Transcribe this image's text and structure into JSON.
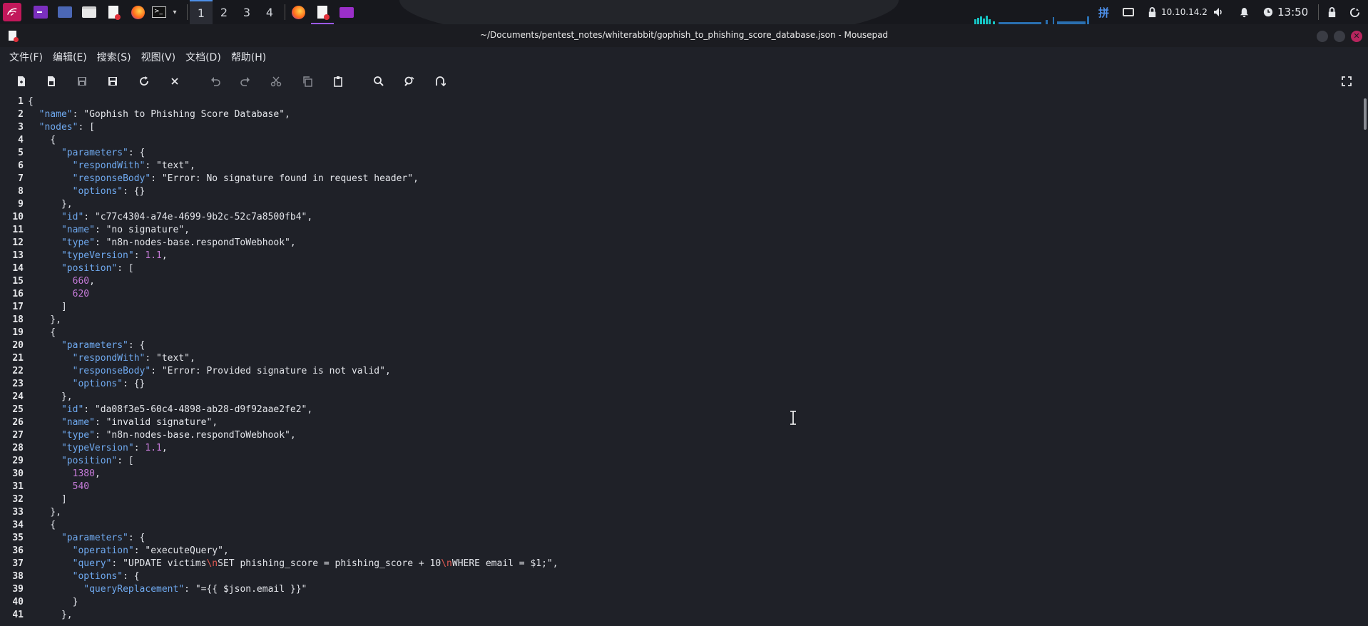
{
  "taskbar": {
    "workspaces": [
      "1",
      "2",
      "3",
      "4"
    ],
    "active_workspace": "1",
    "ip_address": "10.10.14.2",
    "time": "13:50",
    "accent_color": "#9b59f0"
  },
  "window": {
    "title": "~/Documents/pentest_notes/whiterabbit/gophish_to_phishing_score_database.json - Mousepad"
  },
  "menu": [
    "文件(F)",
    "编辑(E)",
    "搜索(S)",
    "视图(V)",
    "文档(D)",
    "帮助(H)"
  ],
  "toolbar": [
    "new-document-icon",
    "new-window-icon",
    "save-icon",
    "save-as-icon",
    "reload-icon",
    "close-icon",
    "undo-icon",
    "redo-icon",
    "cut-icon",
    "copy-icon",
    "paste-icon",
    "search-icon",
    "replace-icon",
    "goto-icon",
    "fullscreen-icon"
  ],
  "editor": {
    "lines": [
      [
        {
          "t": "p",
          "v": "{"
        }
      ],
      [
        {
          "t": "p",
          "v": "  "
        },
        {
          "t": "k",
          "v": "\"name\""
        },
        {
          "t": "p",
          "v": ": "
        },
        {
          "t": "s",
          "v": "\"Gophish to Phishing Score Database\""
        },
        {
          "t": "p",
          "v": ","
        }
      ],
      [
        {
          "t": "p",
          "v": "  "
        },
        {
          "t": "k",
          "v": "\"nodes\""
        },
        {
          "t": "p",
          "v": ": ["
        }
      ],
      [
        {
          "t": "p",
          "v": "    {"
        }
      ],
      [
        {
          "t": "p",
          "v": "      "
        },
        {
          "t": "k",
          "v": "\"parameters\""
        },
        {
          "t": "p",
          "v": ": {"
        }
      ],
      [
        {
          "t": "p",
          "v": "        "
        },
        {
          "t": "k",
          "v": "\"respondWith\""
        },
        {
          "t": "p",
          "v": ": "
        },
        {
          "t": "s",
          "v": "\"text\""
        },
        {
          "t": "p",
          "v": ","
        }
      ],
      [
        {
          "t": "p",
          "v": "        "
        },
        {
          "t": "k",
          "v": "\"responseBody\""
        },
        {
          "t": "p",
          "v": ": "
        },
        {
          "t": "s",
          "v": "\"Error: No signature found in request header\""
        },
        {
          "t": "p",
          "v": ","
        }
      ],
      [
        {
          "t": "p",
          "v": "        "
        },
        {
          "t": "k",
          "v": "\"options\""
        },
        {
          "t": "p",
          "v": ": {}"
        }
      ],
      [
        {
          "t": "p",
          "v": "      },"
        }
      ],
      [
        {
          "t": "p",
          "v": "      "
        },
        {
          "t": "k",
          "v": "\"id\""
        },
        {
          "t": "p",
          "v": ": "
        },
        {
          "t": "s",
          "v": "\"c77c4304-a74e-4699-9b2c-52c7a8500fb4\""
        },
        {
          "t": "p",
          "v": ","
        }
      ],
      [
        {
          "t": "p",
          "v": "      "
        },
        {
          "t": "k",
          "v": "\"name\""
        },
        {
          "t": "p",
          "v": ": "
        },
        {
          "t": "s",
          "v": "\"no signature\""
        },
        {
          "t": "p",
          "v": ","
        }
      ],
      [
        {
          "t": "p",
          "v": "      "
        },
        {
          "t": "k",
          "v": "\"type\""
        },
        {
          "t": "p",
          "v": ": "
        },
        {
          "t": "s",
          "v": "\"n8n-nodes-base.respondToWebhook\""
        },
        {
          "t": "p",
          "v": ","
        }
      ],
      [
        {
          "t": "p",
          "v": "      "
        },
        {
          "t": "k",
          "v": "\"typeVersion\""
        },
        {
          "t": "p",
          "v": ": "
        },
        {
          "t": "n",
          "v": "1.1"
        },
        {
          "t": "p",
          "v": ","
        }
      ],
      [
        {
          "t": "p",
          "v": "      "
        },
        {
          "t": "k",
          "v": "\"position\""
        },
        {
          "t": "p",
          "v": ": ["
        }
      ],
      [
        {
          "t": "p",
          "v": "        "
        },
        {
          "t": "n",
          "v": "660"
        },
        {
          "t": "p",
          "v": ","
        }
      ],
      [
        {
          "t": "p",
          "v": "        "
        },
        {
          "t": "n",
          "v": "620"
        }
      ],
      [
        {
          "t": "p",
          "v": "      ]"
        }
      ],
      [
        {
          "t": "p",
          "v": "    },"
        }
      ],
      [
        {
          "t": "p",
          "v": "    {"
        }
      ],
      [
        {
          "t": "p",
          "v": "      "
        },
        {
          "t": "k",
          "v": "\"parameters\""
        },
        {
          "t": "p",
          "v": ": {"
        }
      ],
      [
        {
          "t": "p",
          "v": "        "
        },
        {
          "t": "k",
          "v": "\"respondWith\""
        },
        {
          "t": "p",
          "v": ": "
        },
        {
          "t": "s",
          "v": "\"text\""
        },
        {
          "t": "p",
          "v": ","
        }
      ],
      [
        {
          "t": "p",
          "v": "        "
        },
        {
          "t": "k",
          "v": "\"responseBody\""
        },
        {
          "t": "p",
          "v": ": "
        },
        {
          "t": "s",
          "v": "\"Error: Provided signature is not valid\""
        },
        {
          "t": "p",
          "v": ","
        }
      ],
      [
        {
          "t": "p",
          "v": "        "
        },
        {
          "t": "k",
          "v": "\"options\""
        },
        {
          "t": "p",
          "v": ": {}"
        }
      ],
      [
        {
          "t": "p",
          "v": "      },"
        }
      ],
      [
        {
          "t": "p",
          "v": "      "
        },
        {
          "t": "k",
          "v": "\"id\""
        },
        {
          "t": "p",
          "v": ": "
        },
        {
          "t": "s",
          "v": "\"da08f3e5-60c4-4898-ab28-d9f92aae2fe2\""
        },
        {
          "t": "p",
          "v": ","
        }
      ],
      [
        {
          "t": "p",
          "v": "      "
        },
        {
          "t": "k",
          "v": "\"name\""
        },
        {
          "t": "p",
          "v": ": "
        },
        {
          "t": "s",
          "v": "\"invalid signature\""
        },
        {
          "t": "p",
          "v": ","
        }
      ],
      [
        {
          "t": "p",
          "v": "      "
        },
        {
          "t": "k",
          "v": "\"type\""
        },
        {
          "t": "p",
          "v": ": "
        },
        {
          "t": "s",
          "v": "\"n8n-nodes-base.respondToWebhook\""
        },
        {
          "t": "p",
          "v": ","
        }
      ],
      [
        {
          "t": "p",
          "v": "      "
        },
        {
          "t": "k",
          "v": "\"typeVersion\""
        },
        {
          "t": "p",
          "v": ": "
        },
        {
          "t": "n",
          "v": "1.1"
        },
        {
          "t": "p",
          "v": ","
        }
      ],
      [
        {
          "t": "p",
          "v": "      "
        },
        {
          "t": "k",
          "v": "\"position\""
        },
        {
          "t": "p",
          "v": ": ["
        }
      ],
      [
        {
          "t": "p",
          "v": "        "
        },
        {
          "t": "n",
          "v": "1380"
        },
        {
          "t": "p",
          "v": ","
        }
      ],
      [
        {
          "t": "p",
          "v": "        "
        },
        {
          "t": "n",
          "v": "540"
        }
      ],
      [
        {
          "t": "p",
          "v": "      ]"
        }
      ],
      [
        {
          "t": "p",
          "v": "    },"
        }
      ],
      [
        {
          "t": "p",
          "v": "    {"
        }
      ],
      [
        {
          "t": "p",
          "v": "      "
        },
        {
          "t": "k",
          "v": "\"parameters\""
        },
        {
          "t": "p",
          "v": ": {"
        }
      ],
      [
        {
          "t": "p",
          "v": "        "
        },
        {
          "t": "k",
          "v": "\"operation\""
        },
        {
          "t": "p",
          "v": ": "
        },
        {
          "t": "s",
          "v": "\"executeQuery\""
        },
        {
          "t": "p",
          "v": ","
        }
      ],
      [
        {
          "t": "p",
          "v": "        "
        },
        {
          "t": "k",
          "v": "\"query\""
        },
        {
          "t": "p",
          "v": ": "
        },
        {
          "t": "s",
          "v": "\"UPDATE victims"
        },
        {
          "t": "e",
          "v": "\\n"
        },
        {
          "t": "s",
          "v": "SET phishing_score = phishing_score + 10"
        },
        {
          "t": "e",
          "v": "\\n"
        },
        {
          "t": "s",
          "v": "WHERE email = $1;\""
        },
        {
          "t": "p",
          "v": ","
        }
      ],
      [
        {
          "t": "p",
          "v": "        "
        },
        {
          "t": "k",
          "v": "\"options\""
        },
        {
          "t": "p",
          "v": ": {"
        }
      ],
      [
        {
          "t": "p",
          "v": "          "
        },
        {
          "t": "k",
          "v": "\"queryReplacement\""
        },
        {
          "t": "p",
          "v": ": "
        },
        {
          "t": "s",
          "v": "\"={{ $json.email }}\""
        }
      ],
      [
        {
          "t": "p",
          "v": "        }"
        }
      ],
      [
        {
          "t": "p",
          "v": "      },"
        }
      ]
    ]
  }
}
